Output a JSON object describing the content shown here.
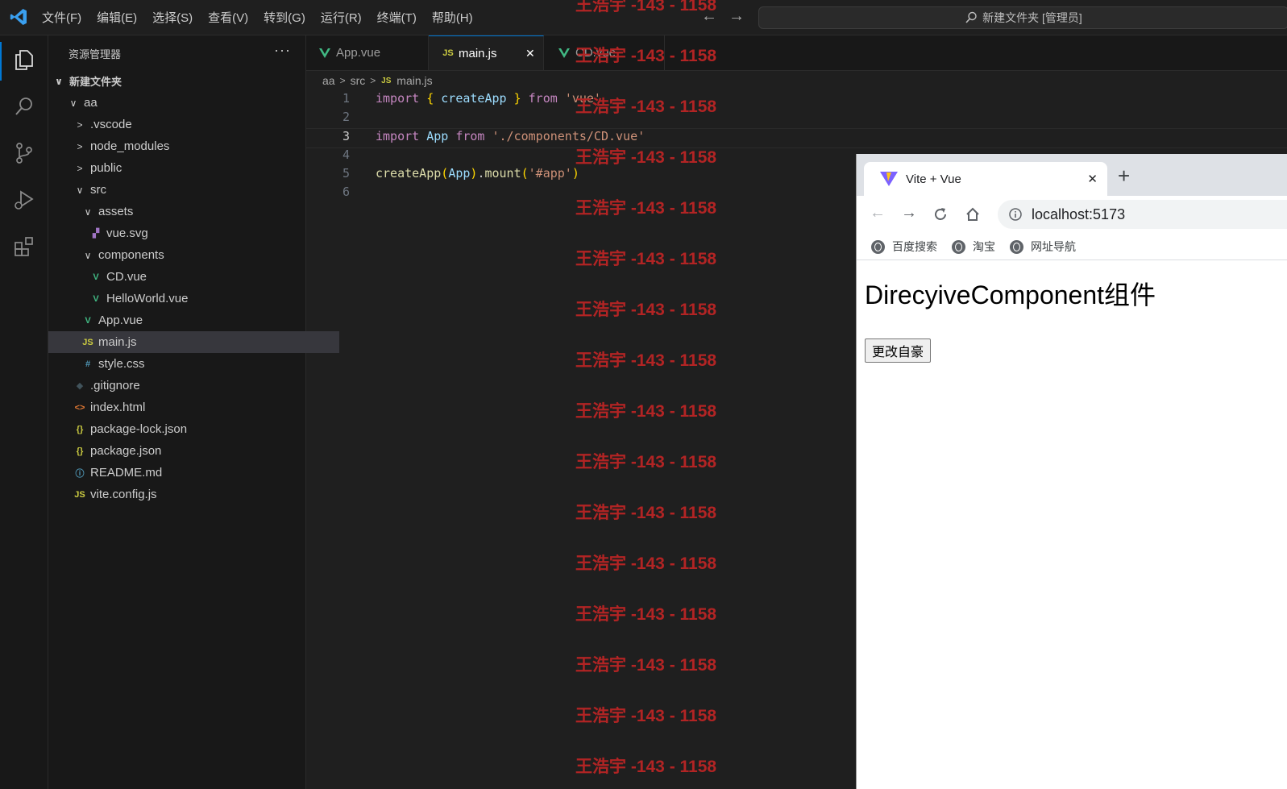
{
  "menu": [
    "文件(F)",
    "编辑(E)",
    "选择(S)",
    "查看(V)",
    "转到(G)",
    "运行(R)",
    "终端(T)",
    "帮助(H)"
  ],
  "command_center": "新建文件夹 [管理员]",
  "explorer": {
    "title": "资源管理器",
    "more": "···",
    "root": "新建文件夹",
    "items": [
      {
        "label": "aa",
        "kind": "folder-open",
        "depth": 1
      },
      {
        "label": ".vscode",
        "kind": "folder",
        "depth": 2
      },
      {
        "label": "node_modules",
        "kind": "folder",
        "depth": 2
      },
      {
        "label": "public",
        "kind": "folder",
        "depth": 2
      },
      {
        "label": "src",
        "kind": "folder-open",
        "depth": 2
      },
      {
        "label": "assets",
        "kind": "folder-open",
        "depth": 3
      },
      {
        "label": "vue.svg",
        "kind": "svg",
        "depth": 4
      },
      {
        "label": "components",
        "kind": "folder-open",
        "depth": 3
      },
      {
        "label": "CD.vue",
        "kind": "vue",
        "depth": 4
      },
      {
        "label": "HelloWorld.vue",
        "kind": "vue",
        "depth": 4
      },
      {
        "label": "App.vue",
        "kind": "vue",
        "depth": 3
      },
      {
        "label": "main.js",
        "kind": "js",
        "depth": 3,
        "selected": true
      },
      {
        "label": "style.css",
        "kind": "css",
        "depth": 3
      },
      {
        "label": ".gitignore",
        "kind": "git",
        "depth": 2
      },
      {
        "label": "index.html",
        "kind": "html",
        "depth": 2
      },
      {
        "label": "package-lock.json",
        "kind": "json",
        "depth": 2
      },
      {
        "label": "package.json",
        "kind": "json",
        "depth": 2
      },
      {
        "label": "README.md",
        "kind": "info",
        "depth": 2
      },
      {
        "label": "vite.config.js",
        "kind": "js",
        "depth": 2
      }
    ]
  },
  "tabs": [
    {
      "label": "App.vue",
      "kind": "vue",
      "active": false
    },
    {
      "label": "main.js",
      "kind": "js",
      "active": true,
      "close": "✕"
    },
    {
      "label": "CD.vue",
      "kind": "vue",
      "active": false
    }
  ],
  "breadcrumb": [
    "aa",
    "src",
    "main.js"
  ],
  "breadcrumb_js_badge": "JS",
  "code": {
    "line_numbers": [
      "1",
      "2",
      "3",
      "4",
      "5",
      "6"
    ],
    "current_line": 3
  },
  "watermark": "王浩宇 -143 - 1158",
  "browser": {
    "tab_title": "Vite + Vue",
    "tab_close": "✕",
    "new_tab": "+",
    "url": "localhost:5173",
    "bookmarks": [
      "百度搜索",
      "淘宝",
      "网址导航"
    ],
    "heading": "DirecyiveComponent组件",
    "button": "更改自豪"
  },
  "colors": {
    "accent": "#0078d4",
    "watermark": "#b22424",
    "vue_green": "#41b883",
    "js_yellow": "#cbcb41"
  }
}
